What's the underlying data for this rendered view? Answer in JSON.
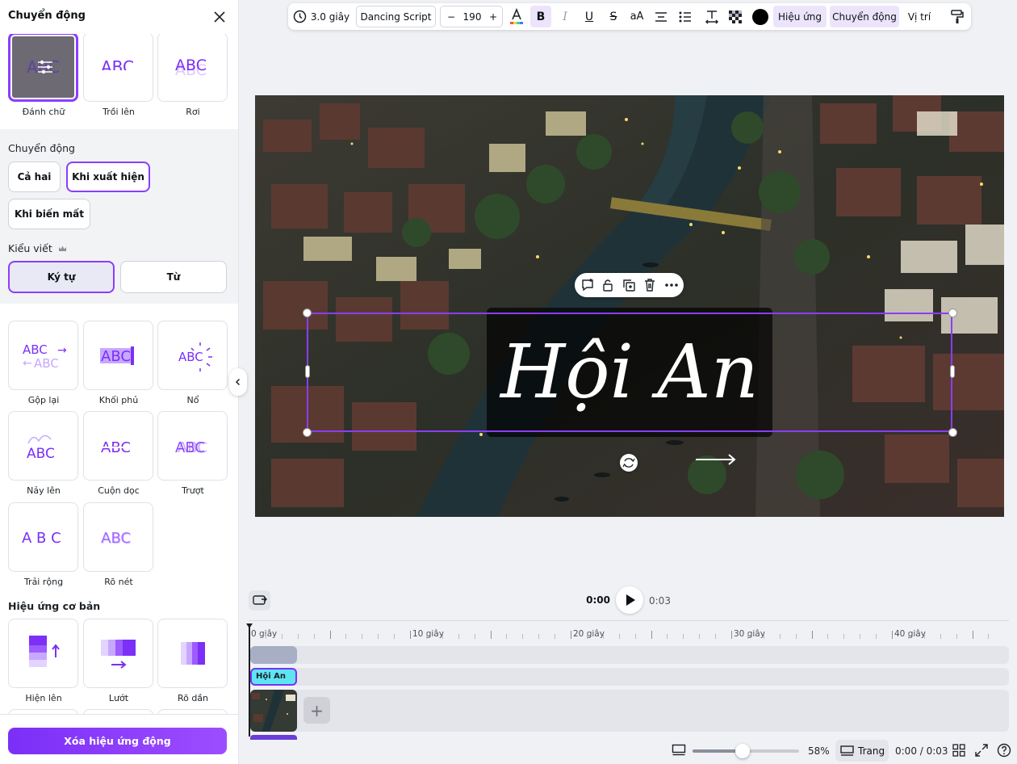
{
  "panel": {
    "title": "Chuyển động",
    "animations_top": [
      {
        "label": "Đánh chữ",
        "selected": true
      },
      {
        "label": "Trồi lên",
        "preview": "ABC"
      },
      {
        "label": "Rơi",
        "preview": "ABC"
      }
    ],
    "motion_label": "Chuyển động",
    "motion_options": [
      "Cả hai",
      "Khi xuất hiện",
      "Khi biến mất"
    ],
    "motion_selected": "Khi xuất hiện",
    "writing_style_label": "Kiểu viết",
    "writing_styles": [
      "Ký tự",
      "Từ"
    ],
    "writing_style_selected": "Ký tự",
    "animations_more": [
      {
        "label": "Gộp lại",
        "preview": "ABC"
      },
      {
        "label": "Khối phủ",
        "preview": "ABC"
      },
      {
        "label": "Nổ",
        "preview": "ABC"
      },
      {
        "label": "Nảy lên",
        "preview": "ABC"
      },
      {
        "label": "Cuộn dọc",
        "preview": "ABC"
      },
      {
        "label": "Trượt",
        "preview": "ABC"
      },
      {
        "label": "Trải rộng",
        "preview": "A B C"
      },
      {
        "label": "Rõ nét",
        "preview": "ABC"
      }
    ],
    "basic_effects_heading": "Hiệu ứng cơ bản",
    "basic_effects": [
      {
        "label": "Hiện lên"
      },
      {
        "label": "Lướt"
      },
      {
        "label": "Rõ dần"
      }
    ],
    "remove_button": "Xóa hiệu ứng động"
  },
  "toolbar": {
    "duration": "3.0 giây",
    "font": "Dancing Script",
    "minus": "−",
    "font_size": "190",
    "plus": "+",
    "bold": "B",
    "italic": "I",
    "underline": "U",
    "strike": "S",
    "case": "aA",
    "effects": "Hiệu ứng",
    "animate": "Chuyển động",
    "position": "Vị trí"
  },
  "canvas": {
    "text": "Hội An"
  },
  "timeline": {
    "current_time": "0:00",
    "total_time": "0:03",
    "ruler_labels": [
      "0 giây",
      "10 giây",
      "20 giây",
      "30 giây",
      "40 giây"
    ],
    "text_clip": "Hội An",
    "add": "+"
  },
  "status": {
    "zoom": "58%",
    "zoom_fraction": 0.47,
    "page_view": "Trang",
    "time_progress": "0:00 / 0:03"
  },
  "colors": {
    "accent": "#8b3dff",
    "text_clip": "#5ee5f2",
    "text_color": "#000000"
  }
}
